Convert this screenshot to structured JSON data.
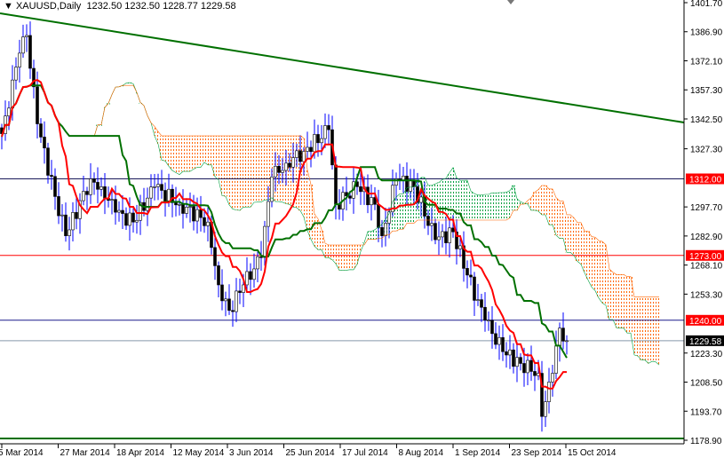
{
  "header": {
    "symbol": "XAUUSD,Daily",
    "ohlc": "1232.50 1232.50 1228.77 1229.58"
  },
  "chart_data": {
    "type": "candlestick",
    "title": "XAUUSD,Daily",
    "indicator": "Ichimoku Kinko Hyo",
    "ylim": [
      1178.9,
      1401.7
    ],
    "y_ticks": [
      "1401.70",
      "1386.90",
      "1372.10",
      "1357.30",
      "1342.50",
      "1327.30",
      "1297.70",
      "1282.90",
      "1268.10",
      "1253.30",
      "1223.30",
      "1208.50",
      "1193.70",
      "1178.90"
    ],
    "x_ticks": [
      "5 Mar 2014",
      "27 Mar 2014",
      "18 Apr 2014",
      "12 May 2014",
      "3 Jun 2014",
      "25 Jun 2014",
      "17 Jul 2014",
      "8 Aug 2014",
      "1 Sep 2014",
      "23 Sep 2014",
      "15 Oct 2014"
    ],
    "close_keypoints": [
      [
        0,
        1335
      ],
      [
        1,
        1344
      ],
      [
        5,
        1376
      ],
      [
        7,
        1385
      ],
      [
        10,
        1340
      ],
      [
        15,
        1303
      ],
      [
        18,
        1283
      ],
      [
        25,
        1312
      ],
      [
        28,
        1308
      ],
      [
        32,
        1295
      ],
      [
        37,
        1290
      ],
      [
        43,
        1308
      ],
      [
        50,
        1299
      ],
      [
        58,
        1290
      ],
      [
        61,
        1258
      ],
      [
        64,
        1245
      ],
      [
        68,
        1258
      ],
      [
        73,
        1272
      ],
      [
        76,
        1313
      ],
      [
        80,
        1320
      ],
      [
        85,
        1326
      ],
      [
        92,
        1337
      ],
      [
        94,
        1299
      ],
      [
        100,
        1308
      ],
      [
        105,
        1299
      ],
      [
        107,
        1283
      ],
      [
        111,
        1312
      ],
      [
        116,
        1308
      ],
      [
        122,
        1281
      ],
      [
        127,
        1285
      ],
      [
        131,
        1263
      ],
      [
        136,
        1240
      ],
      [
        141,
        1224
      ],
      [
        146,
        1218
      ],
      [
        151,
        1213
      ],
      [
        152,
        1191
      ],
      [
        155,
        1213
      ],
      [
        157,
        1236
      ],
      [
        159,
        1229.58
      ]
    ],
    "last_price": "1229.58",
    "levels": [
      {
        "value": "1312.00",
        "color": "#ff0000",
        "line": "#1a1a5a"
      },
      {
        "value": "1273.00",
        "color": "#ff0000",
        "line": "#ff0000"
      },
      {
        "value": "1240.00",
        "color": "#ff0000",
        "line": "#1a1a8a"
      }
    ],
    "support_line": 1179.8,
    "trendline": {
      "from": [
        0,
        1396.3
      ],
      "to_bar_price": 1340.7
    },
    "colors": {
      "tenkan": "#ff0000",
      "kijun": "#007000",
      "bull_cloud": "#00a040",
      "bear_cloud": "#ff6600",
      "trend": "#007000",
      "wick": "#0000ff"
    }
  }
}
